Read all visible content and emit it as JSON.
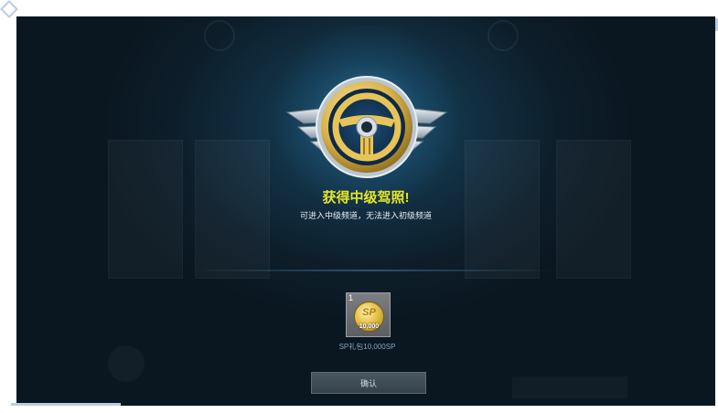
{
  "modal": {
    "title": "获得中级驾照!",
    "subtitle": "可进入中级频道，无法进入初级频道",
    "badge_icon": "steering-wheel-wings-icon",
    "reward": {
      "quantity": "1",
      "coin_symbol": "SP",
      "coin_amount": "10,000",
      "name": "SP礼包10,000SP",
      "icon": "sp-coin-icon"
    },
    "confirm_label": "确认"
  },
  "colors": {
    "title": "#e6e627",
    "background": "#0d1e2a",
    "glow": "#50b4e6",
    "badge_gold": "#d8b24a",
    "badge_silver": "#c9d3dc"
  }
}
